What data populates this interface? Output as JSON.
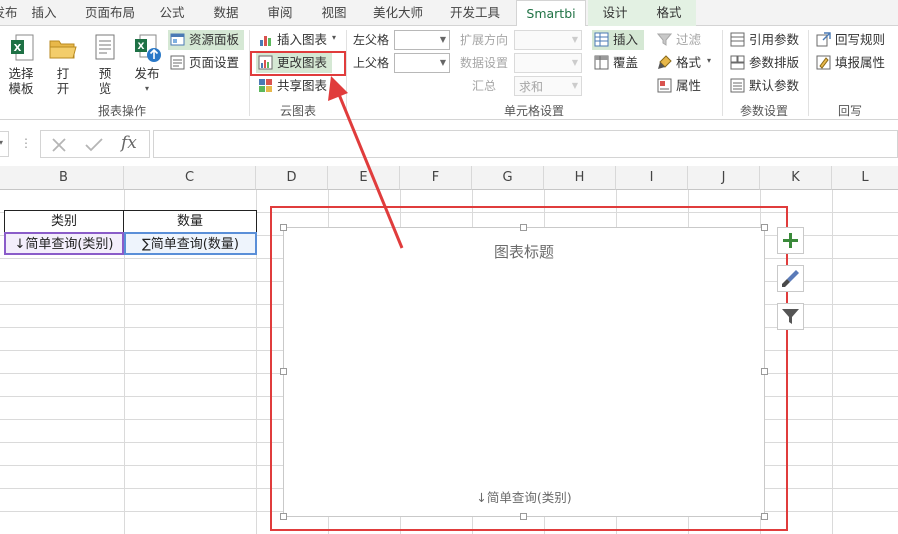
{
  "tabs": [
    {
      "label": "发布",
      "active": false
    },
    {
      "label": "插入",
      "active": false
    },
    {
      "label": "页面布局",
      "active": false
    },
    {
      "label": "公式",
      "active": false
    },
    {
      "label": "数据",
      "active": false
    },
    {
      "label": "审阅",
      "active": false
    },
    {
      "label": "视图",
      "active": false
    },
    {
      "label": "美化大师",
      "active": false
    },
    {
      "label": "开发工具",
      "active": false
    },
    {
      "label": "Smartbi",
      "active": true
    },
    {
      "label": "设计",
      "active": false
    },
    {
      "label": "格式",
      "active": false
    }
  ],
  "ribbon": {
    "report_ops": {
      "select_template": "选择\n模板",
      "open": "打\n开",
      "preview": "预\n览",
      "publish": "发布",
      "resource_panel": "资源面板",
      "page_setup": "页面设置",
      "group_label": "报表操作"
    },
    "cloud_chart": {
      "insert_chart": "插入图表",
      "change_chart": "更改图表",
      "share_chart": "共享图表",
      "group_label": "云图表"
    },
    "cell_settings": {
      "left_parent": "左父格",
      "up_parent": "上父格",
      "expand_direction": "扩展方向",
      "data_settings": "数据设置",
      "summary": "汇总",
      "summary_value": "求和",
      "insert": "插入",
      "overwrite": "覆盖",
      "filter": "过滤",
      "format": "格式",
      "property": "属性",
      "group_label": "单元格设置"
    },
    "param_settings": {
      "ref_params": "引用参数",
      "param_layout": "参数排版",
      "default_params": "默认参数",
      "group_label": "参数设置"
    },
    "writeback": {
      "writeback_rules": "回写规则",
      "fill_property": "填报属性",
      "group_label": "回写"
    }
  },
  "formula_bar": {
    "fx": "fx",
    "value": ""
  },
  "columns": [
    "B",
    "C",
    "D",
    "E",
    "F",
    "G",
    "H",
    "I",
    "J",
    "K",
    "L"
  ],
  "table": {
    "header_category": "类别",
    "header_quantity": "数量",
    "cell_category": "↓简单查询(类别)",
    "cell_quantity": "∑简单查询(数量)"
  },
  "chart": {
    "title": "图表标题",
    "axis_label": "↓简单查询(类别)"
  },
  "colors": {
    "accent_green": "#217346",
    "annotation_red": "#e03c3c",
    "highlight_green": "#d5e8d4"
  }
}
